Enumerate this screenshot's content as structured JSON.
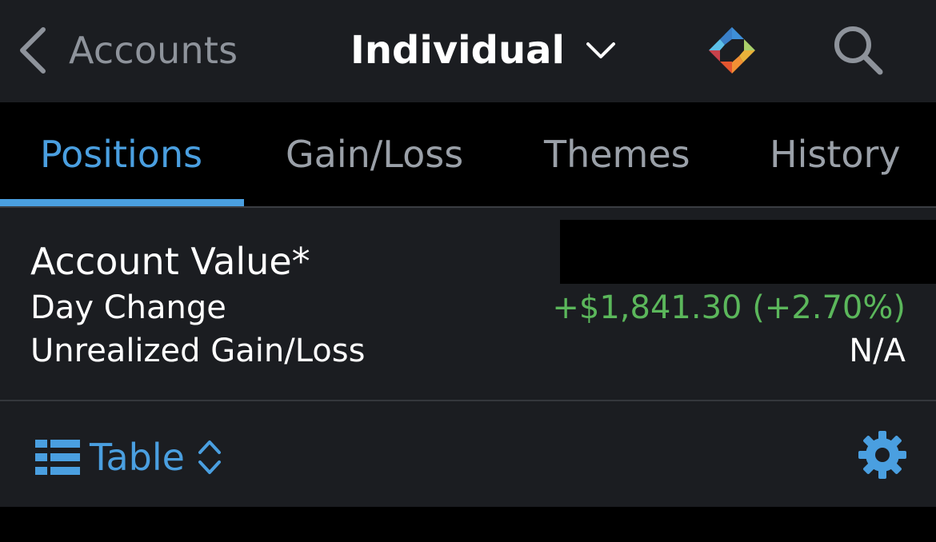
{
  "header": {
    "back_label": "Accounts",
    "account_name": "Individual",
    "icons": [
      "chevron-left-icon",
      "chevron-down-icon",
      "app-logo",
      "search-icon"
    ]
  },
  "tabs": [
    {
      "label": "Positions",
      "active": true
    },
    {
      "label": "Gain/Loss",
      "active": false
    },
    {
      "label": "Themes",
      "active": false
    },
    {
      "label": "History",
      "active": false
    }
  ],
  "summary": {
    "account_value_label": "Account Value*",
    "account_value": "",
    "day_change_label": "Day Change",
    "day_change_value": "+$1,841.30 (+2.70%)",
    "unrealized_label": "Unrealized Gain/Loss",
    "unrealized_value": "N/A"
  },
  "toolbar": {
    "view_label": "Table",
    "icons": [
      "table-view-icon",
      "up-down-chevron-icon",
      "gear-icon"
    ]
  },
  "colors": {
    "accent": "#4a9fe0",
    "positive": "#5bb75b",
    "panel": "#1b1d21",
    "muted": "#8e939b"
  }
}
